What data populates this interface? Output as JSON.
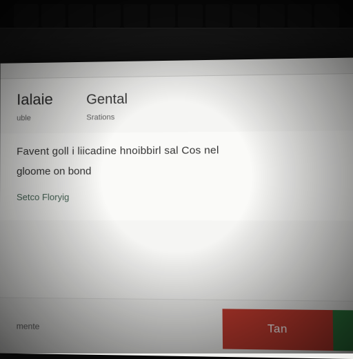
{
  "dialog": {
    "tabs": {
      "main": "Ialaie",
      "side": "Gental",
      "sub1": "uble",
      "sub2": "Srations"
    },
    "body": {
      "line1": "Favent goll i liicadine hnoibbirl sal Cos nel",
      "line2": "gloome on bond",
      "link": "Setco Floryig"
    },
    "footer": {
      "note": "mente",
      "primary_label": "Tan"
    }
  },
  "colors": {
    "danger": "#c13b2f",
    "accent": "#2f7a3f",
    "bg": "#f5f5f3"
  }
}
